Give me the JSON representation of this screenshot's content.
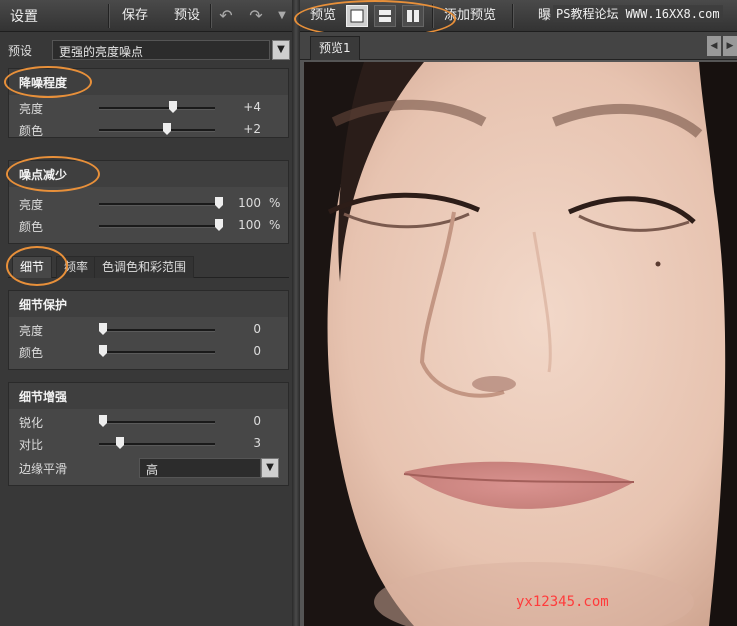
{
  "header": {
    "title": "设置",
    "save_label": "保存",
    "preset_label": "预设",
    "preview_label": "预览",
    "add_preview_label": "添加预览",
    "exposure_label": "曝"
  },
  "preset": {
    "label": "预设",
    "value": "更强的亮度噪点"
  },
  "noise_level": {
    "title": "降噪程度",
    "rows": [
      {
        "label": "亮度",
        "value": "+4",
        "level": 0.6
      },
      {
        "label": "颜色",
        "value": "+2",
        "level": 0.55
      }
    ]
  },
  "noise_reduction": {
    "title": "噪点减少",
    "rows": [
      {
        "label": "亮度",
        "value": "100",
        "unit": "%",
        "level": 1.0
      },
      {
        "label": "颜色",
        "value": "100",
        "unit": "%",
        "level": 1.0
      }
    ]
  },
  "tabs": [
    "细节",
    "频率",
    "色调色和彩范围"
  ],
  "detail_protect": {
    "title": "细节保护",
    "rows": [
      {
        "label": "亮度",
        "value": "0",
        "level": 0.0
      },
      {
        "label": "颜色",
        "value": "0",
        "level": 0.0
      }
    ]
  },
  "detail_enhance": {
    "title": "细节增强",
    "rows": [
      {
        "label": "锐化",
        "value": "0",
        "level": 0.0
      },
      {
        "label": "对比",
        "value": "3",
        "level": 0.15
      }
    ],
    "edge_label": "边缘平滑",
    "edge_value": "高"
  },
  "preview": {
    "tab_label": "预览1"
  },
  "watermarks": {
    "top": "PS教程论坛 WWW.16XX8.com",
    "bottom": "yx12345.com"
  },
  "colors": {
    "highlight": "#e8903a",
    "watermark_bottom": "#ff3b3b"
  }
}
